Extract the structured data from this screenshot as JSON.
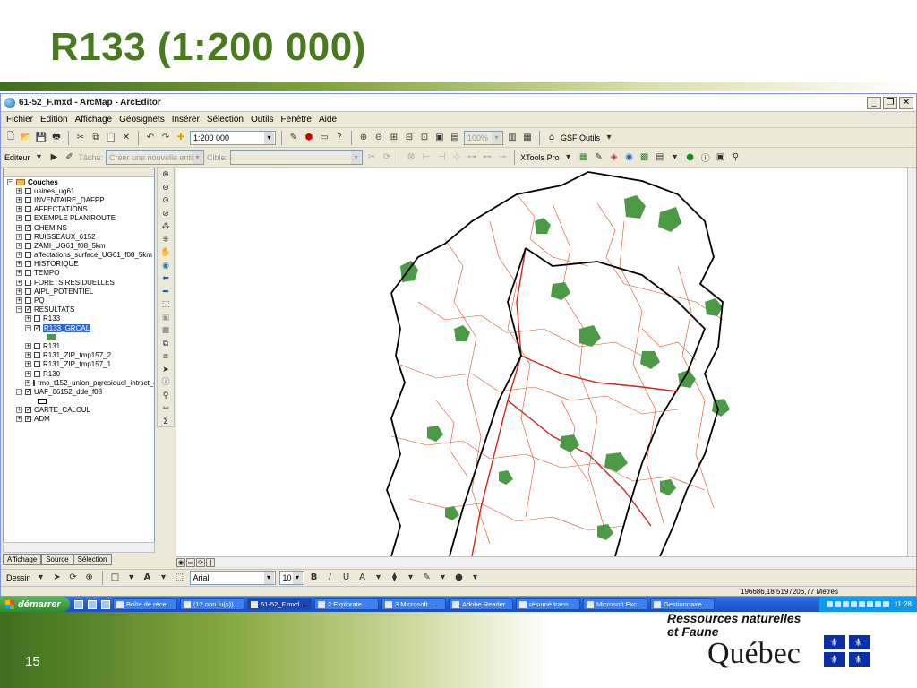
{
  "slide": {
    "title": "R133 (1:200 000)",
    "page_number": "15",
    "ministry_line1": "Ressources naturelles",
    "ministry_line2": "et Faune",
    "quebec": "Québec",
    "fleur": "⚜"
  },
  "window": {
    "title": "61-52_F.mxd - ArcMap - ArcEditor",
    "buttons": {
      "minimize": "_",
      "restore": "❐",
      "close": "✕"
    }
  },
  "menu": [
    "Fichier",
    "Edition",
    "Affichage",
    "Géosignets",
    "Insérer",
    "Sélection",
    "Outils",
    "Fenêtre",
    "Aide"
  ],
  "toolbar1": {
    "scale": "1:200 000",
    "zoom": "100%",
    "gsf": "GSF Outils"
  },
  "toolbar2": {
    "editor": "Editeur",
    "task_label": "Tâche:",
    "task_value": "Créer une nouvelle entité",
    "target_label": "Cible:",
    "target_value": "",
    "xtools": "XTools Pro"
  },
  "toc": {
    "root": "Couches",
    "layers": [
      {
        "name": "usines_ug61",
        "checked": false,
        "expanded": false,
        "indent": 1
      },
      {
        "name": "INVENTAIRE_DAFPP",
        "checked": false,
        "expanded": false,
        "indent": 1
      },
      {
        "name": "AFFECTATIONS",
        "checked": false,
        "expanded": false,
        "indent": 1
      },
      {
        "name": "EXEMPLE PLANIROUTE",
        "checked": false,
        "expanded": false,
        "indent": 1
      },
      {
        "name": "CHEMINS",
        "checked": true,
        "expanded": false,
        "indent": 1
      },
      {
        "name": "RUISSEAUX_6152",
        "checked": false,
        "expanded": false,
        "indent": 1
      },
      {
        "name": "ZAMI_UG61_f08_5km",
        "checked": false,
        "expanded": false,
        "indent": 1
      },
      {
        "name": "affectations_surface_UG61_f08_5km",
        "checked": false,
        "expanded": false,
        "indent": 1
      },
      {
        "name": "HISTORIQUE",
        "checked": false,
        "expanded": false,
        "indent": 1
      },
      {
        "name": "TEMPO",
        "checked": false,
        "expanded": false,
        "indent": 1
      },
      {
        "name": "FORETS RESIDUELLES",
        "checked": false,
        "expanded": false,
        "indent": 1
      },
      {
        "name": "AIPL_POTENTIEL",
        "checked": false,
        "expanded": false,
        "indent": 1
      },
      {
        "name": "PQ",
        "checked": false,
        "expanded": false,
        "indent": 1
      },
      {
        "name": "RESULTATS",
        "checked": true,
        "expanded": true,
        "indent": 1
      },
      {
        "name": "R133",
        "checked": false,
        "expanded": false,
        "indent": 2
      },
      {
        "name": "R133_GRCAL",
        "checked": true,
        "expanded": true,
        "indent": 2,
        "selected": true
      },
      {
        "name": "",
        "swatch": "#4c9a45",
        "indent": 3
      },
      {
        "name": "R131",
        "checked": false,
        "expanded": false,
        "indent": 2
      },
      {
        "name": "R131_ZIP_tmp157_2",
        "checked": false,
        "expanded": false,
        "indent": 2
      },
      {
        "name": "R131_ZIP_tmp157_1",
        "checked": false,
        "expanded": false,
        "indent": 2
      },
      {
        "name": "R130",
        "checked": false,
        "expanded": false,
        "indent": 2
      },
      {
        "name": "tmo_t152_union_pqresiduel_intrsct_c",
        "checked": false,
        "expanded": false,
        "indent": 2
      },
      {
        "name": "UAF_06152_dde_f08",
        "checked": true,
        "expanded": true,
        "indent": 1
      },
      {
        "name": "",
        "swatch": "outline",
        "indent": 2
      },
      {
        "name": "CARTE_CALCUL",
        "checked": true,
        "expanded": false,
        "indent": 1
      },
      {
        "name": "ADM",
        "checked": true,
        "expanded": false,
        "indent": 1
      }
    ],
    "tabs": [
      "Affichage",
      "Source",
      "Sélection"
    ]
  },
  "drawbar": {
    "dessin": "Dessin",
    "font": "Arial",
    "size": "10",
    "bold": "B",
    "italic": "I",
    "underline": "U",
    "text_a": "A"
  },
  "status": {
    "coords": "196686,18  5197206,77 Mètres"
  },
  "taskbar": {
    "start": "démarrer",
    "tasks": [
      {
        "label": "Boîte de réce...",
        "active": false
      },
      {
        "label": "(12 non lu(s))...",
        "active": false
      },
      {
        "label": "61-52_F.mxd...",
        "active": true
      },
      {
        "label": "2 Explorate...",
        "active": false
      },
      {
        "label": "3 Microsoft ...",
        "active": false
      },
      {
        "label": "Adobe Reader",
        "active": false
      },
      {
        "label": "résumé trans...",
        "active": false
      },
      {
        "label": "Microsoft Exc...",
        "active": false
      },
      {
        "label": "Gestionnaire ...",
        "active": false
      }
    ],
    "clock": "11:28"
  },
  "colors": {
    "title_green": "#4a7a20",
    "forest_green": "#4c9a45",
    "road_red": "#e0401a",
    "boundary_black": "#000000"
  }
}
